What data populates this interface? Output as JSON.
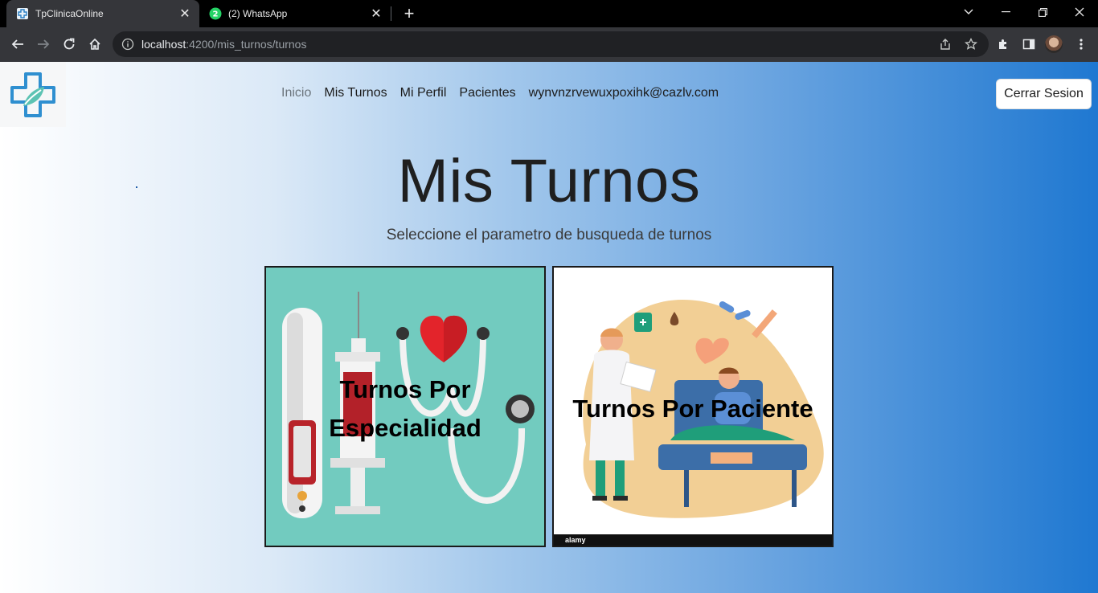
{
  "browser": {
    "tabs": [
      {
        "title": "TpClinicaOnline",
        "active": true,
        "icon": "site-favicon-icon"
      },
      {
        "title": "(2) WhatsApp",
        "active": false,
        "icon": "whatsapp-icon",
        "badge": "2"
      }
    ],
    "url_host": "localhost",
    "url_path": ":4200/mis_turnos/turnos"
  },
  "nav": {
    "items": [
      {
        "label": "Inicio",
        "active": true
      },
      {
        "label": "Mis Turnos",
        "active": false
      },
      {
        "label": "Mi Perfil",
        "active": false
      },
      {
        "label": "Pacientes",
        "active": false
      },
      {
        "label": "wynvnzrvewuxpoxihk@cazlv.com",
        "active": false
      }
    ],
    "logout_label": "Cerrar Sesion"
  },
  "main": {
    "title": "Mis Turnos",
    "subtitle": "Seleccione el parametro de busqueda de turnos",
    "cards": [
      {
        "label": "Turnos Por Especialidad"
      },
      {
        "label": "Turnos Por Paciente",
        "watermark": "alamy"
      }
    ]
  },
  "colors": {
    "accent_blue": "#1f78d1",
    "teal": "#72cbbf",
    "chrome_dark": "#35363a"
  }
}
